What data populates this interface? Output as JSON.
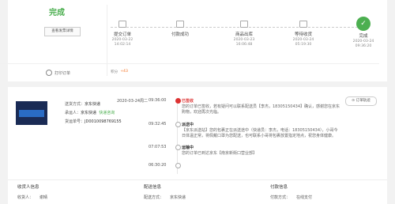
{
  "summary": {
    "status": "完成",
    "invoice_button": "查看发票详情",
    "print_label": "打印订单",
    "points_label": "积分",
    "points_value": "+43"
  },
  "progress": {
    "steps": [
      {
        "label": "提交订单",
        "date": "2020-03-22",
        "time": "14:02:14"
      },
      {
        "label": "付款成功",
        "date": "",
        "time": ""
      },
      {
        "label": "商品出库",
        "date": "2020-03-23",
        "time": "16:06:48"
      },
      {
        "label": "等待收货",
        "date": "2020-03-24",
        "time": "05:19:30"
      },
      {
        "label": "完成",
        "date": "2020-03-24",
        "time": "09:36:20"
      }
    ],
    "current_index": 4
  },
  "shipping": {
    "method_label": "送货方式：",
    "method_value": "京东快递",
    "carrier_label": "承运人：",
    "carrier_value": "京东快递",
    "carrier_badge": "快递咨询",
    "tracking_label": "货运单号：",
    "tracking_value": "JD0010098769155",
    "track_button": "订单轨迹"
  },
  "log": [
    {
      "date": "2020-03-24周二",
      "time": "09:36:00",
      "title": "已签收",
      "desc": "您的订单已签收，若有疑问可以联系配送员【李杰，18305150434】确认，感谢您在京东购物，欢迎再次光临。"
    },
    {
      "date": "",
      "time": "09:32:45",
      "title": "派送中",
      "desc": "【京东派送站】您的包裹正在派送途中（快递员：李杰，电话：18305150434），小哥今日体温正常，将佩戴口罩为您配送，也可联系小哥将包裹放置指定地点，祝您身体健康。"
    },
    {
      "date": "",
      "time": "07:07:53",
      "title": "运输中",
      "desc": "您的订单已到达京东【南京新街口营业部】"
    },
    {
      "date": "",
      "time": "06:30:20",
      "title": "",
      "desc": ""
    }
  ],
  "info": [
    {
      "header": "收货人信息",
      "rows": [
        {
          "label": "收货人：",
          "value": "谢晴"
        }
      ]
    },
    {
      "header": "配送信息",
      "rows": [
        {
          "label": "配送方式：",
          "value": "京东快递"
        }
      ]
    },
    {
      "header": "付款信息",
      "rows": [
        {
          "label": "付款方式：",
          "value": "在线支付"
        }
      ]
    }
  ]
}
